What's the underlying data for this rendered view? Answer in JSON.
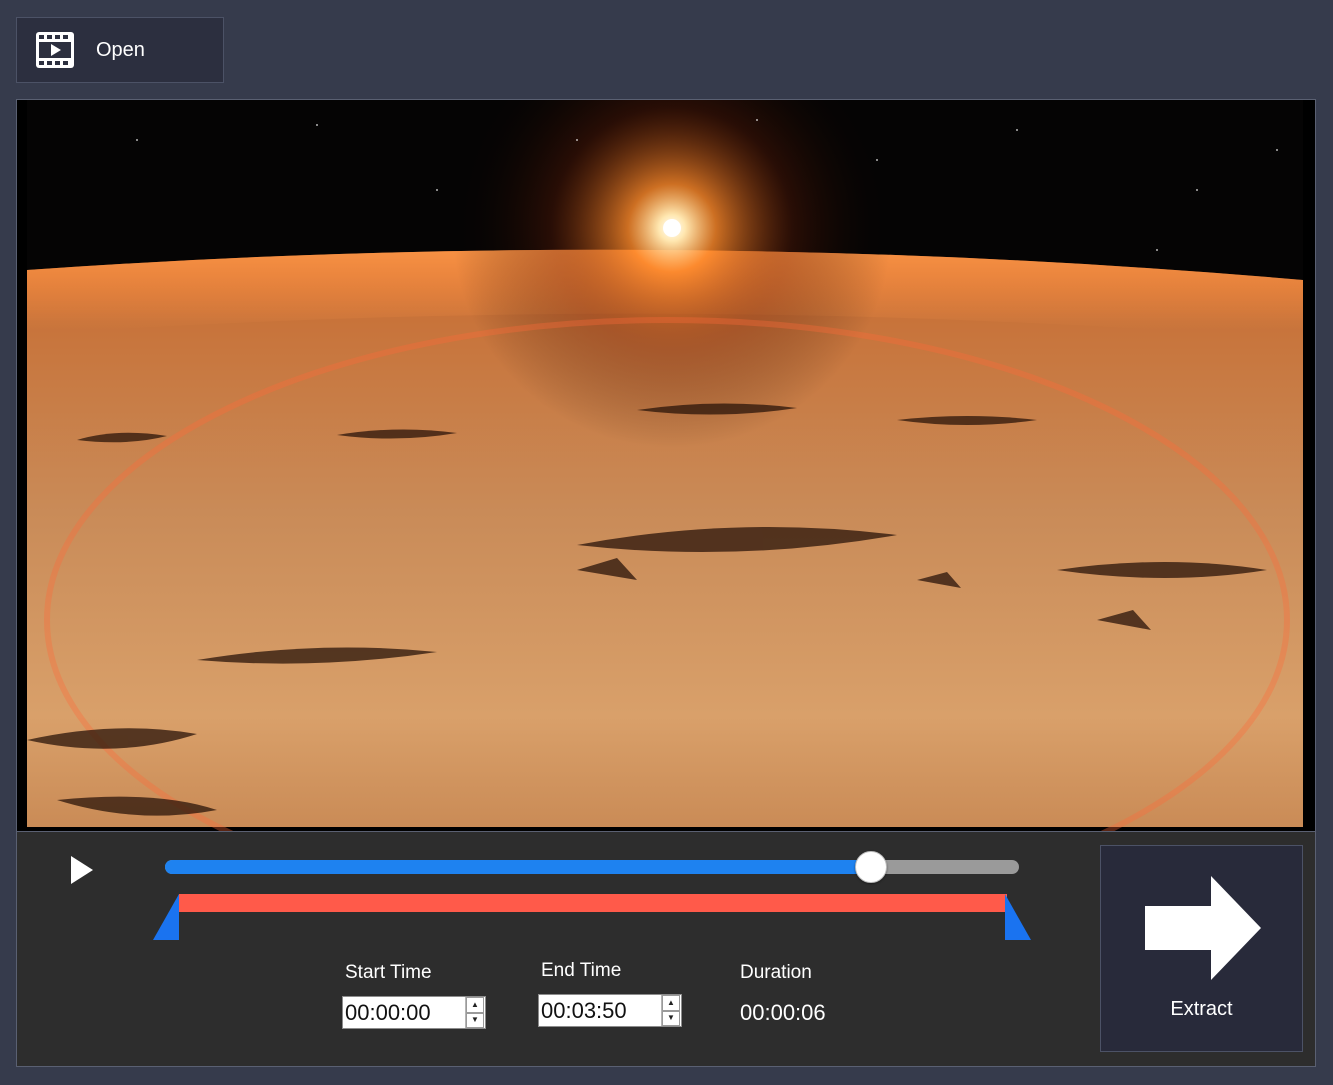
{
  "toolbar": {
    "open_label": "Open",
    "open_icon": "film-play-icon"
  },
  "player": {
    "play_icon": "play-icon",
    "progress_fraction": 0.827
  },
  "trim": {
    "start_fraction": 0.0,
    "end_fraction": 1.0,
    "start_label": "Start Time",
    "start_value": "00:00:00",
    "end_label": "End Time",
    "end_value": "00:03:50",
    "duration_label": "Duration",
    "duration_value": "00:00:06"
  },
  "extract": {
    "label": "Extract",
    "icon": "right-arrow-icon"
  },
  "colors": {
    "background": "#363b4c",
    "progress": "#1e82f0",
    "range": "#ff5a4a",
    "handle": "#1a73f0"
  }
}
